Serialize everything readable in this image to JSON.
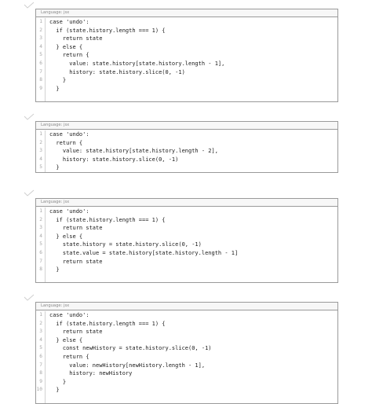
{
  "blocks": [
    {
      "language_label": "Language: jsx",
      "lines": [
        "case 'undo':",
        "  if (state.history.length === 1) {",
        "    return state",
        "  } else {",
        "    return {",
        "      value: state.history[state.history.length - 1],",
        "      history: state.history.slice(0, -1)",
        "    }",
        "  }",
        ""
      ],
      "line_numbers": [
        "1",
        "2",
        "3",
        "4",
        "5",
        "6",
        "7",
        "8",
        "9"
      ]
    },
    {
      "language_label": "Language: jsx",
      "lines": [
        "case 'undo':",
        "  return {",
        "    value: state.history[state.history.length - 2],",
        "    history: state.history.slice(0, -1)",
        "  }"
      ],
      "line_numbers": [
        "1",
        "2",
        "3",
        "4",
        "5"
      ]
    },
    {
      "language_label": "Language: jsx",
      "lines": [
        "case 'undo':",
        "  if (state.history.length === 1) {",
        "    return state",
        "  } else {",
        "    state.history = state.history.slice(0, -1)",
        "    state.value = state.history[state.history.length - 1]",
        "    return state",
        "  }",
        ""
      ],
      "line_numbers": [
        "1",
        "2",
        "3",
        "4",
        "5",
        "6",
        "7",
        "8"
      ]
    },
    {
      "language_label": "Language: jsx",
      "lines": [
        "case 'undo':",
        "  if (state.history.length === 1) {",
        "    return state",
        "  } else {",
        "    const newHistory = state.history.slice(0, -1)",
        "    return {",
        "      value: newHistory[newHistory.length - 1],",
        "      history: newHistory",
        "    }",
        "  }",
        ""
      ],
      "line_numbers": [
        "1",
        "2",
        "3",
        "4",
        "5",
        "6",
        "7",
        "8",
        "9",
        "10"
      ]
    }
  ]
}
